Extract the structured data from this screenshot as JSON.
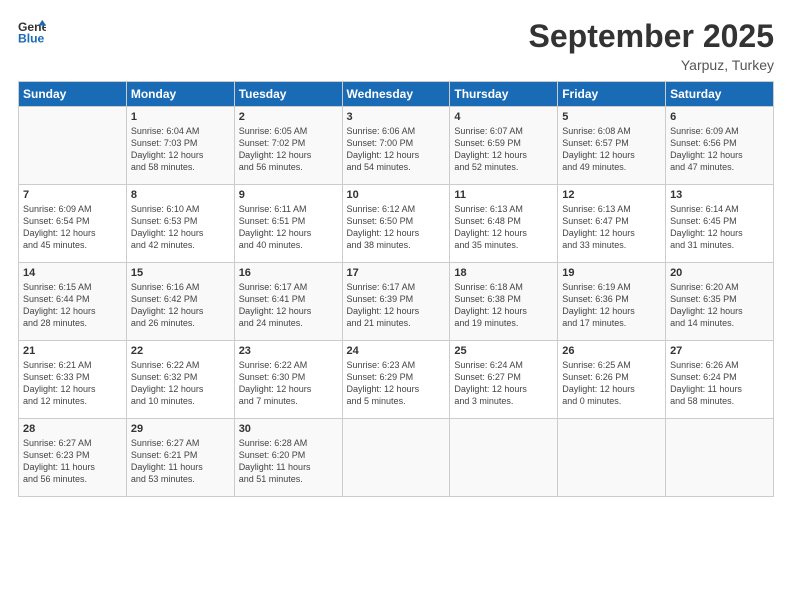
{
  "header": {
    "logo_line1": "General",
    "logo_line2": "Blue",
    "month": "September 2025",
    "location": "Yarpuz, Turkey"
  },
  "weekdays": [
    "Sunday",
    "Monday",
    "Tuesday",
    "Wednesday",
    "Thursday",
    "Friday",
    "Saturday"
  ],
  "rows": [
    [
      {
        "day": "",
        "text": ""
      },
      {
        "day": "1",
        "text": "Sunrise: 6:04 AM\nSunset: 7:03 PM\nDaylight: 12 hours\nand 58 minutes."
      },
      {
        "day": "2",
        "text": "Sunrise: 6:05 AM\nSunset: 7:02 PM\nDaylight: 12 hours\nand 56 minutes."
      },
      {
        "day": "3",
        "text": "Sunrise: 6:06 AM\nSunset: 7:00 PM\nDaylight: 12 hours\nand 54 minutes."
      },
      {
        "day": "4",
        "text": "Sunrise: 6:07 AM\nSunset: 6:59 PM\nDaylight: 12 hours\nand 52 minutes."
      },
      {
        "day": "5",
        "text": "Sunrise: 6:08 AM\nSunset: 6:57 PM\nDaylight: 12 hours\nand 49 minutes."
      },
      {
        "day": "6",
        "text": "Sunrise: 6:09 AM\nSunset: 6:56 PM\nDaylight: 12 hours\nand 47 minutes."
      }
    ],
    [
      {
        "day": "7",
        "text": "Sunrise: 6:09 AM\nSunset: 6:54 PM\nDaylight: 12 hours\nand 45 minutes."
      },
      {
        "day": "8",
        "text": "Sunrise: 6:10 AM\nSunset: 6:53 PM\nDaylight: 12 hours\nand 42 minutes."
      },
      {
        "day": "9",
        "text": "Sunrise: 6:11 AM\nSunset: 6:51 PM\nDaylight: 12 hours\nand 40 minutes."
      },
      {
        "day": "10",
        "text": "Sunrise: 6:12 AM\nSunset: 6:50 PM\nDaylight: 12 hours\nand 38 minutes."
      },
      {
        "day": "11",
        "text": "Sunrise: 6:13 AM\nSunset: 6:48 PM\nDaylight: 12 hours\nand 35 minutes."
      },
      {
        "day": "12",
        "text": "Sunrise: 6:13 AM\nSunset: 6:47 PM\nDaylight: 12 hours\nand 33 minutes."
      },
      {
        "day": "13",
        "text": "Sunrise: 6:14 AM\nSunset: 6:45 PM\nDaylight: 12 hours\nand 31 minutes."
      }
    ],
    [
      {
        "day": "14",
        "text": "Sunrise: 6:15 AM\nSunset: 6:44 PM\nDaylight: 12 hours\nand 28 minutes."
      },
      {
        "day": "15",
        "text": "Sunrise: 6:16 AM\nSunset: 6:42 PM\nDaylight: 12 hours\nand 26 minutes."
      },
      {
        "day": "16",
        "text": "Sunrise: 6:17 AM\nSunset: 6:41 PM\nDaylight: 12 hours\nand 24 minutes."
      },
      {
        "day": "17",
        "text": "Sunrise: 6:17 AM\nSunset: 6:39 PM\nDaylight: 12 hours\nand 21 minutes."
      },
      {
        "day": "18",
        "text": "Sunrise: 6:18 AM\nSunset: 6:38 PM\nDaylight: 12 hours\nand 19 minutes."
      },
      {
        "day": "19",
        "text": "Sunrise: 6:19 AM\nSunset: 6:36 PM\nDaylight: 12 hours\nand 17 minutes."
      },
      {
        "day": "20",
        "text": "Sunrise: 6:20 AM\nSunset: 6:35 PM\nDaylight: 12 hours\nand 14 minutes."
      }
    ],
    [
      {
        "day": "21",
        "text": "Sunrise: 6:21 AM\nSunset: 6:33 PM\nDaylight: 12 hours\nand 12 minutes."
      },
      {
        "day": "22",
        "text": "Sunrise: 6:22 AM\nSunset: 6:32 PM\nDaylight: 12 hours\nand 10 minutes."
      },
      {
        "day": "23",
        "text": "Sunrise: 6:22 AM\nSunset: 6:30 PM\nDaylight: 12 hours\nand 7 minutes."
      },
      {
        "day": "24",
        "text": "Sunrise: 6:23 AM\nSunset: 6:29 PM\nDaylight: 12 hours\nand 5 minutes."
      },
      {
        "day": "25",
        "text": "Sunrise: 6:24 AM\nSunset: 6:27 PM\nDaylight: 12 hours\nand 3 minutes."
      },
      {
        "day": "26",
        "text": "Sunrise: 6:25 AM\nSunset: 6:26 PM\nDaylight: 12 hours\nand 0 minutes."
      },
      {
        "day": "27",
        "text": "Sunrise: 6:26 AM\nSunset: 6:24 PM\nDaylight: 11 hours\nand 58 minutes."
      }
    ],
    [
      {
        "day": "28",
        "text": "Sunrise: 6:27 AM\nSunset: 6:23 PM\nDaylight: 11 hours\nand 56 minutes."
      },
      {
        "day": "29",
        "text": "Sunrise: 6:27 AM\nSunset: 6:21 PM\nDaylight: 11 hours\nand 53 minutes."
      },
      {
        "day": "30",
        "text": "Sunrise: 6:28 AM\nSunset: 6:20 PM\nDaylight: 11 hours\nand 51 minutes."
      },
      {
        "day": "",
        "text": ""
      },
      {
        "day": "",
        "text": ""
      },
      {
        "day": "",
        "text": ""
      },
      {
        "day": "",
        "text": ""
      }
    ]
  ]
}
